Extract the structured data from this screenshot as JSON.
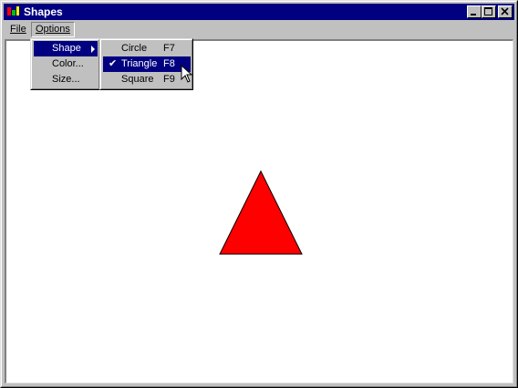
{
  "window": {
    "title": "Shapes"
  },
  "menubar": {
    "file": "File",
    "options": "Options"
  },
  "options_menu": {
    "shape": "Shape",
    "color": "Color...",
    "size": "Size..."
  },
  "shape_menu": {
    "circle": {
      "label": "Circle",
      "shortcut": "F7",
      "checked": false
    },
    "triangle": {
      "label": "Triangle",
      "shortcut": "F8",
      "checked": true
    },
    "square": {
      "label": "Square",
      "shortcut": "F9",
      "checked": false
    }
  },
  "canvas": {
    "shape": "triangle",
    "fill_color": "#ff0000"
  },
  "colors": {
    "titlebar": "#000080",
    "highlight": "#000080",
    "face": "#c0c0c0"
  }
}
